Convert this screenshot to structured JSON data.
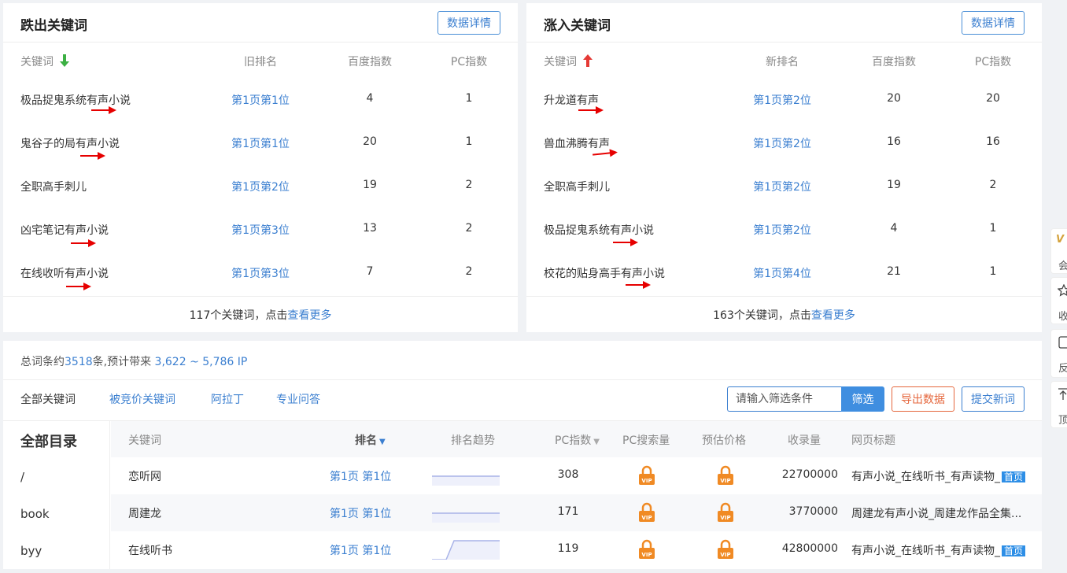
{
  "panel_out": {
    "title": "跌出关键词",
    "detail_btn": "数据详情",
    "headers": {
      "keyword": "关键词",
      "rank": "旧排名",
      "baidu_index": "百度指数",
      "pc_index": "PC指数"
    },
    "rows": [
      {
        "keyword": "极品捉鬼系统有声小说",
        "rank": "第1页第1位",
        "baidu_index": "4",
        "pc_index": "1"
      },
      {
        "keyword": "鬼谷子的局有声小说",
        "rank": "第1页第1位",
        "baidu_index": "20",
        "pc_index": "1"
      },
      {
        "keyword": "全职高手刺儿",
        "rank": "第1页第2位",
        "baidu_index": "19",
        "pc_index": "2"
      },
      {
        "keyword": "凶宅笔记有声小说",
        "rank": "第1页第3位",
        "baidu_index": "13",
        "pc_index": "2"
      },
      {
        "keyword": "在线收听有声小说",
        "rank": "第1页第3位",
        "baidu_index": "7",
        "pc_index": "2"
      }
    ],
    "footer_text": "117个关键词，点击",
    "footer_link": "查看更多"
  },
  "panel_in": {
    "title": "涨入关键词",
    "detail_btn": "数据详情",
    "headers": {
      "keyword": "关键词",
      "rank": "新排名",
      "baidu_index": "百度指数",
      "pc_index": "PC指数"
    },
    "rows": [
      {
        "keyword": "升龙道有声",
        "rank": "第1页第2位",
        "baidu_index": "20",
        "pc_index": "20"
      },
      {
        "keyword": "兽血沸腾有声",
        "rank": "第1页第2位",
        "baidu_index": "16",
        "pc_index": "16"
      },
      {
        "keyword": "全职高手刺儿",
        "rank": "第1页第2位",
        "baidu_index": "19",
        "pc_index": "2"
      },
      {
        "keyword": "极品捉鬼系统有声小说",
        "rank": "第1页第2位",
        "baidu_index": "4",
        "pc_index": "1"
      },
      {
        "keyword": "校花的贴身高手有声小说",
        "rank": "第1页第4位",
        "baidu_index": "21",
        "pc_index": "1"
      }
    ],
    "footer_text": "163个关键词，点击",
    "footer_link": "查看更多"
  },
  "summary": {
    "prefix": "总词条约",
    "count": "3518",
    "middle": "条,预计带来",
    "ip_range": "3,622 ~ 5,786 IP"
  },
  "tabs": [
    "全部关键词",
    "被竞价关键词",
    "阿拉丁",
    "专业问答"
  ],
  "filter": {
    "placeholder": "请输入筛选条件",
    "button": "筛选"
  },
  "export_btn": "导出数据",
  "submit_btn": "提交新词",
  "directory": {
    "title": "全部目录",
    "items": [
      "/",
      "book",
      "byy"
    ]
  },
  "table": {
    "headers": [
      "关键词",
      "排名",
      "排名趋势",
      "PC指数",
      "PC搜索量",
      "预估价格",
      "收录量",
      "网页标题"
    ],
    "rows": [
      {
        "keyword": "恋听网",
        "rank": "第1页 第1位",
        "pc_index": "308",
        "indexed": "22700000",
        "title": "有声小说_在线听书_有声读物_",
        "badge": "首页"
      },
      {
        "keyword": "周建龙",
        "rank": "第1页 第1位",
        "pc_index": "171",
        "indexed": "3770000",
        "title": "周建龙有声小说_周建龙作品全集...",
        "badge": ""
      },
      {
        "keyword": "在线听书",
        "rank": "第1页 第1位",
        "pc_index": "119",
        "indexed": "42800000",
        "title": "有声小说_在线听书_有声读物_",
        "badge": "首页"
      }
    ]
  },
  "side_float": {
    "items": [
      "会",
      "收",
      "反",
      "顶"
    ]
  },
  "colors": {
    "accent": "#3b7fd0",
    "down_arrow": "#3cb043",
    "up_arrow": "#e53935",
    "annotation": "#e60000",
    "vip": "#f08a24",
    "export": "#e5673d"
  }
}
